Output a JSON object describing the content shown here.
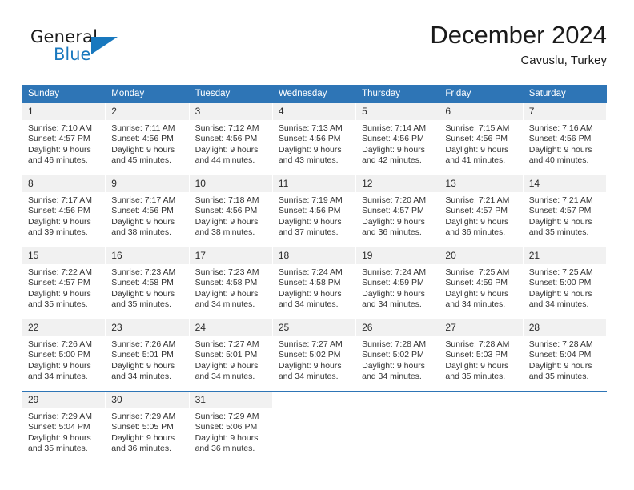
{
  "brand": {
    "name_top": "General",
    "name_bottom": "Blue",
    "triangle_color": "#1878be",
    "accent_color": "#2e75b6"
  },
  "header": {
    "title": "December 2024",
    "location": "Cavuslu, Turkey"
  },
  "calendar": {
    "weekday_headers": [
      "Sunday",
      "Monday",
      "Tuesday",
      "Wednesday",
      "Thursday",
      "Friday",
      "Saturday"
    ],
    "header_bg": "#2e75b6",
    "header_text_color": "#ffffff",
    "daynum_bg": "#f1f1f1",
    "weeks": [
      [
        {
          "day": "1",
          "sunrise": "Sunrise: 7:10 AM",
          "sunset": "Sunset: 4:57 PM",
          "daylight1": "Daylight: 9 hours",
          "daylight2": "and 46 minutes."
        },
        {
          "day": "2",
          "sunrise": "Sunrise: 7:11 AM",
          "sunset": "Sunset: 4:56 PM",
          "daylight1": "Daylight: 9 hours",
          "daylight2": "and 45 minutes."
        },
        {
          "day": "3",
          "sunrise": "Sunrise: 7:12 AM",
          "sunset": "Sunset: 4:56 PM",
          "daylight1": "Daylight: 9 hours",
          "daylight2": "and 44 minutes."
        },
        {
          "day": "4",
          "sunrise": "Sunrise: 7:13 AM",
          "sunset": "Sunset: 4:56 PM",
          "daylight1": "Daylight: 9 hours",
          "daylight2": "and 43 minutes."
        },
        {
          "day": "5",
          "sunrise": "Sunrise: 7:14 AM",
          "sunset": "Sunset: 4:56 PM",
          "daylight1": "Daylight: 9 hours",
          "daylight2": "and 42 minutes."
        },
        {
          "day": "6",
          "sunrise": "Sunrise: 7:15 AM",
          "sunset": "Sunset: 4:56 PM",
          "daylight1": "Daylight: 9 hours",
          "daylight2": "and 41 minutes."
        },
        {
          "day": "7",
          "sunrise": "Sunrise: 7:16 AM",
          "sunset": "Sunset: 4:56 PM",
          "daylight1": "Daylight: 9 hours",
          "daylight2": "and 40 minutes."
        }
      ],
      [
        {
          "day": "8",
          "sunrise": "Sunrise: 7:17 AM",
          "sunset": "Sunset: 4:56 PM",
          "daylight1": "Daylight: 9 hours",
          "daylight2": "and 39 minutes."
        },
        {
          "day": "9",
          "sunrise": "Sunrise: 7:17 AM",
          "sunset": "Sunset: 4:56 PM",
          "daylight1": "Daylight: 9 hours",
          "daylight2": "and 38 minutes."
        },
        {
          "day": "10",
          "sunrise": "Sunrise: 7:18 AM",
          "sunset": "Sunset: 4:56 PM",
          "daylight1": "Daylight: 9 hours",
          "daylight2": "and 38 minutes."
        },
        {
          "day": "11",
          "sunrise": "Sunrise: 7:19 AM",
          "sunset": "Sunset: 4:56 PM",
          "daylight1": "Daylight: 9 hours",
          "daylight2": "and 37 minutes."
        },
        {
          "day": "12",
          "sunrise": "Sunrise: 7:20 AM",
          "sunset": "Sunset: 4:57 PM",
          "daylight1": "Daylight: 9 hours",
          "daylight2": "and 36 minutes."
        },
        {
          "day": "13",
          "sunrise": "Sunrise: 7:21 AM",
          "sunset": "Sunset: 4:57 PM",
          "daylight1": "Daylight: 9 hours",
          "daylight2": "and 36 minutes."
        },
        {
          "day": "14",
          "sunrise": "Sunrise: 7:21 AM",
          "sunset": "Sunset: 4:57 PM",
          "daylight1": "Daylight: 9 hours",
          "daylight2": "and 35 minutes."
        }
      ],
      [
        {
          "day": "15",
          "sunrise": "Sunrise: 7:22 AM",
          "sunset": "Sunset: 4:57 PM",
          "daylight1": "Daylight: 9 hours",
          "daylight2": "and 35 minutes."
        },
        {
          "day": "16",
          "sunrise": "Sunrise: 7:23 AM",
          "sunset": "Sunset: 4:58 PM",
          "daylight1": "Daylight: 9 hours",
          "daylight2": "and 35 minutes."
        },
        {
          "day": "17",
          "sunrise": "Sunrise: 7:23 AM",
          "sunset": "Sunset: 4:58 PM",
          "daylight1": "Daylight: 9 hours",
          "daylight2": "and 34 minutes."
        },
        {
          "day": "18",
          "sunrise": "Sunrise: 7:24 AM",
          "sunset": "Sunset: 4:58 PM",
          "daylight1": "Daylight: 9 hours",
          "daylight2": "and 34 minutes."
        },
        {
          "day": "19",
          "sunrise": "Sunrise: 7:24 AM",
          "sunset": "Sunset: 4:59 PM",
          "daylight1": "Daylight: 9 hours",
          "daylight2": "and 34 minutes."
        },
        {
          "day": "20",
          "sunrise": "Sunrise: 7:25 AM",
          "sunset": "Sunset: 4:59 PM",
          "daylight1": "Daylight: 9 hours",
          "daylight2": "and 34 minutes."
        },
        {
          "day": "21",
          "sunrise": "Sunrise: 7:25 AM",
          "sunset": "Sunset: 5:00 PM",
          "daylight1": "Daylight: 9 hours",
          "daylight2": "and 34 minutes."
        }
      ],
      [
        {
          "day": "22",
          "sunrise": "Sunrise: 7:26 AM",
          "sunset": "Sunset: 5:00 PM",
          "daylight1": "Daylight: 9 hours",
          "daylight2": "and 34 minutes."
        },
        {
          "day": "23",
          "sunrise": "Sunrise: 7:26 AM",
          "sunset": "Sunset: 5:01 PM",
          "daylight1": "Daylight: 9 hours",
          "daylight2": "and 34 minutes."
        },
        {
          "day": "24",
          "sunrise": "Sunrise: 7:27 AM",
          "sunset": "Sunset: 5:01 PM",
          "daylight1": "Daylight: 9 hours",
          "daylight2": "and 34 minutes."
        },
        {
          "day": "25",
          "sunrise": "Sunrise: 7:27 AM",
          "sunset": "Sunset: 5:02 PM",
          "daylight1": "Daylight: 9 hours",
          "daylight2": "and 34 minutes."
        },
        {
          "day": "26",
          "sunrise": "Sunrise: 7:28 AM",
          "sunset": "Sunset: 5:02 PM",
          "daylight1": "Daylight: 9 hours",
          "daylight2": "and 34 minutes."
        },
        {
          "day": "27",
          "sunrise": "Sunrise: 7:28 AM",
          "sunset": "Sunset: 5:03 PM",
          "daylight1": "Daylight: 9 hours",
          "daylight2": "and 35 minutes."
        },
        {
          "day": "28",
          "sunrise": "Sunrise: 7:28 AM",
          "sunset": "Sunset: 5:04 PM",
          "daylight1": "Daylight: 9 hours",
          "daylight2": "and 35 minutes."
        }
      ],
      [
        {
          "day": "29",
          "sunrise": "Sunrise: 7:29 AM",
          "sunset": "Sunset: 5:04 PM",
          "daylight1": "Daylight: 9 hours",
          "daylight2": "and 35 minutes."
        },
        {
          "day": "30",
          "sunrise": "Sunrise: 7:29 AM",
          "sunset": "Sunset: 5:05 PM",
          "daylight1": "Daylight: 9 hours",
          "daylight2": "and 36 minutes."
        },
        {
          "day": "31",
          "sunrise": "Sunrise: 7:29 AM",
          "sunset": "Sunset: 5:06 PM",
          "daylight1": "Daylight: 9 hours",
          "daylight2": "and 36 minutes."
        },
        {
          "day": "",
          "sunrise": "",
          "sunset": "",
          "daylight1": "",
          "daylight2": ""
        },
        {
          "day": "",
          "sunrise": "",
          "sunset": "",
          "daylight1": "",
          "daylight2": ""
        },
        {
          "day": "",
          "sunrise": "",
          "sunset": "",
          "daylight1": "",
          "daylight2": ""
        },
        {
          "day": "",
          "sunrise": "",
          "sunset": "",
          "daylight1": "",
          "daylight2": ""
        }
      ]
    ]
  }
}
